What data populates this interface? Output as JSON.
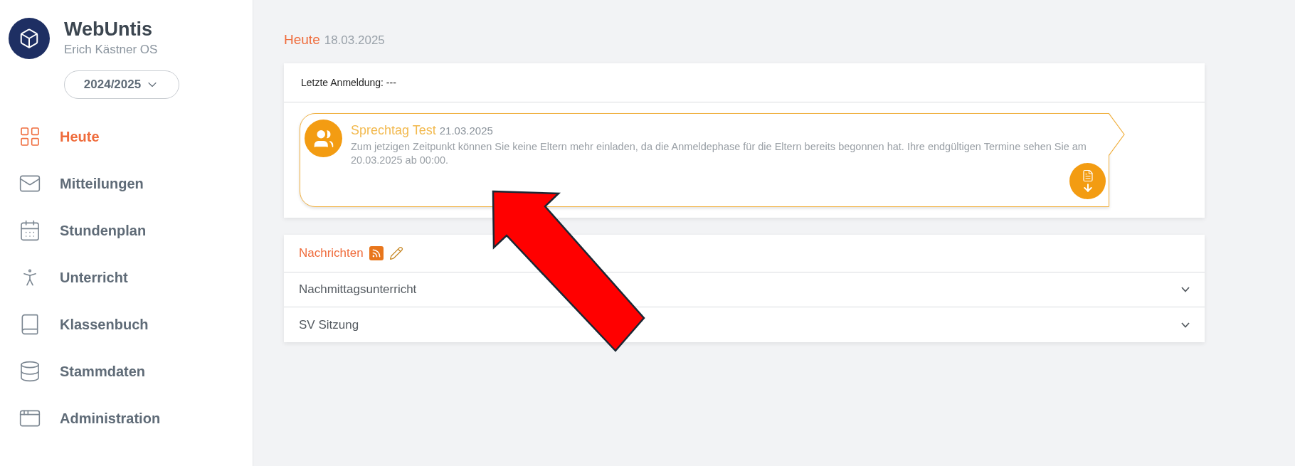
{
  "brand": {
    "title": "WebUntis",
    "subtitle": "Erich Kästner OS"
  },
  "school_year": "2024/2025",
  "nav": [
    {
      "label": "Heute",
      "selected": true
    },
    {
      "label": "Mitteilungen",
      "selected": false
    },
    {
      "label": "Stundenplan",
      "selected": false
    },
    {
      "label": "Unterricht",
      "selected": false
    },
    {
      "label": "Klassenbuch",
      "selected": false
    },
    {
      "label": "Stammdaten",
      "selected": false
    },
    {
      "label": "Administration",
      "selected": false
    }
  ],
  "heading": {
    "title": "Heute",
    "date": "18.03.2025"
  },
  "last_login": "Letzte Anmeldung: ---",
  "event": {
    "title": "Sprechtag Test",
    "date": "21.03.2025",
    "text": "Zum jetzigen Zeitpunkt können Sie keine Eltern mehr einladen, da die Anmeldephase für die Eltern bereits begonnen hat. Ihre endgültigen Termine sehen Sie am 20.03.2025 ab 00:00."
  },
  "news": {
    "title": "Nachrichten",
    "items": [
      {
        "title": "Nachmittagsunterricht",
        "expanded": false
      },
      {
        "title": "SV Sitzung",
        "expanded": false
      }
    ]
  }
}
